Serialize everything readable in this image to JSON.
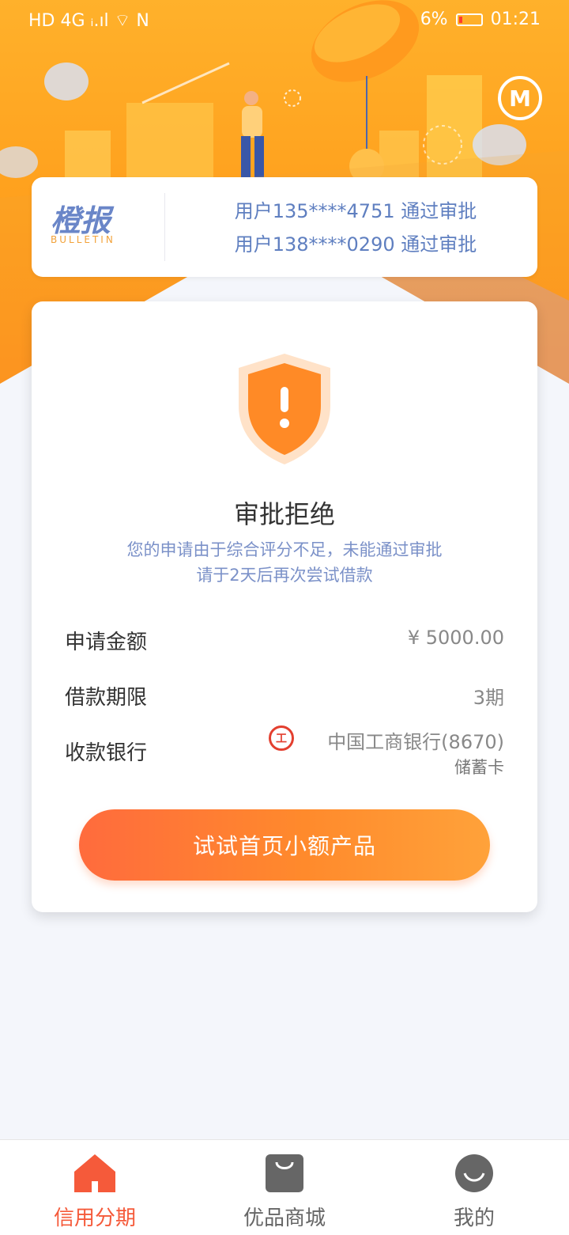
{
  "status_bar": {
    "left": "HD 4G ᵢ.ıl ⌔ N",
    "battery": "6%",
    "time": "01:21"
  },
  "bulletin": {
    "logo_cn": "橙报",
    "logo_en": "BULLETIN",
    "items": [
      {
        "text": "用户135****4751 通过审批"
      },
      {
        "text": "用户138****0290 通过审批"
      }
    ]
  },
  "result": {
    "title": "审批拒绝",
    "desc1": "您的申请由于综合评分不足，未能通过审批",
    "desc2": "请于2天后再次尝试借款"
  },
  "details": {
    "amount_label": "申请金额",
    "amount_value": "¥ 5000.00",
    "term_label": "借款期限",
    "term_value": "3期",
    "bank_label": "收款银行",
    "bank_value": "中国工商银行(8670)",
    "bank_card_type": "储蓄卡"
  },
  "cta_label": "试试首页小额产品",
  "tabs": [
    {
      "label": "信用分期",
      "icon": "home-icon",
      "active": true
    },
    {
      "label": "优品商城",
      "icon": "shopping-bag-icon",
      "active": false
    },
    {
      "label": "我的",
      "icon": "profile-icon",
      "active": false
    }
  ],
  "colors": {
    "accent": "#ff6b3d",
    "active_tab": "#f55a3a",
    "bulletin_text": "#5f7fc0"
  }
}
